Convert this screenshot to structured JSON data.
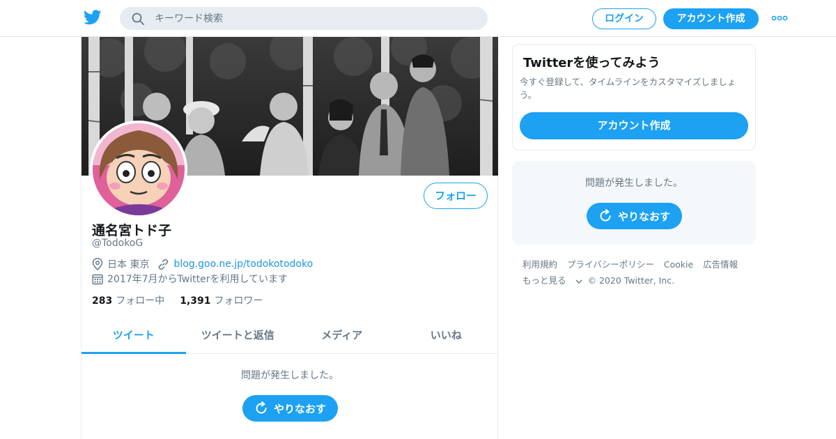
{
  "header": {
    "search_placeholder": "キーワード検索",
    "login_label": "ログイン",
    "signup_label": "アカウント作成"
  },
  "profile": {
    "display_name": "通名宮トド子",
    "handle": "@TodokoG",
    "location": "日本 東京",
    "website": "blog.goo.ne.jp/todokotodoko",
    "joined": "2017年7月からTwitterを利用しています",
    "following_count": "283",
    "following_label": "フォロー中",
    "followers_count": "1,391",
    "followers_label": "フォロワー",
    "follow_button": "フォロー"
  },
  "tabs": [
    {
      "label": "ツイート",
      "active": true
    },
    {
      "label": "ツイートと返信",
      "active": false
    },
    {
      "label": "メディア",
      "active": false
    },
    {
      "label": "いいね",
      "active": false
    }
  ],
  "timeline": {
    "error_text": "問題が発生しました。",
    "retry_label": "やりなおす"
  },
  "sidebar": {
    "signup_card": {
      "title": "Twitterを使ってみよう",
      "description": "今すぐ登録して、タイムラインをカスタマイズしましょう。",
      "button": "アカウント作成"
    },
    "error_card": {
      "error_text": "問題が発生しました。",
      "retry_label": "やりなおす"
    },
    "footer_links": [
      "利用規約",
      "プライバシーポリシー",
      "Cookie",
      "広告情報"
    ],
    "more_label": "もっと見る",
    "copyright": "© 2020 Twitter, Inc."
  },
  "colors": {
    "accent": "#1da1f2",
    "link": "#1b95e0",
    "secondary_text": "#657786"
  },
  "icons": {
    "logo": "twitter-bird-icon",
    "search": "search-icon",
    "more": "more-dots-icon",
    "location": "location-pin-icon",
    "link": "link-icon",
    "calendar": "calendar-icon",
    "retry": "refresh-icon"
  }
}
